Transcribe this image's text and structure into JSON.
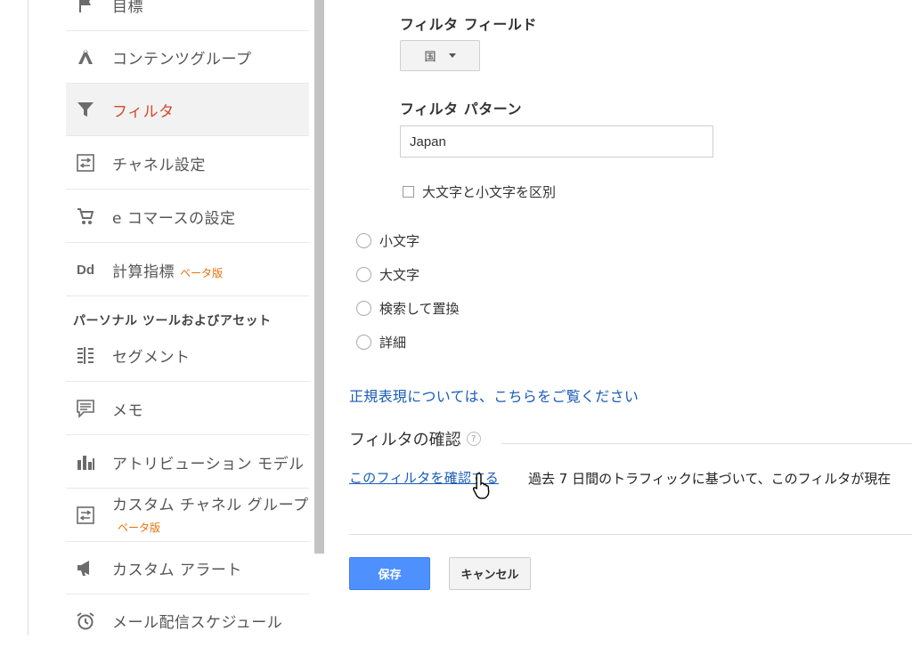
{
  "sidebar": {
    "items": [
      {
        "label": "目標",
        "icon": "flag-icon"
      },
      {
        "label": "コンテンツグループ",
        "icon": "content-group-icon"
      },
      {
        "label": "フィルタ",
        "icon": "filter-icon",
        "active": true
      },
      {
        "label": "チャネル設定",
        "icon": "channel-settings-icon"
      },
      {
        "label": "e コマースの設定",
        "icon": "cart-icon"
      },
      {
        "label": "計算指標",
        "icon": "dd-icon",
        "icon_text": "Dd",
        "badge": "ベータ版"
      },
      {
        "label": "セグメント",
        "icon": "segment-icon"
      },
      {
        "label": "メモ",
        "icon": "memo-icon"
      },
      {
        "label": "アトリビューション モデル",
        "icon": "attribution-icon"
      },
      {
        "label": "カスタム チャネル グループ",
        "icon": "custom-channel-icon",
        "badge": "ベータ版"
      },
      {
        "label": "カスタム アラート",
        "icon": "megaphone-icon"
      },
      {
        "label": "メール配信スケジュール",
        "icon": "alarm-clock-icon"
      }
    ],
    "section_title": "パーソナル ツールおよびアセット"
  },
  "form": {
    "filter_field_label": "フィルタ フィールド",
    "filter_field_value": "国",
    "filter_pattern_label": "フィルタ パターン",
    "filter_pattern_value": "Japan",
    "case_sensitive_label": "大文字と小文字を区別",
    "radio_options": [
      "小文字",
      "大文字",
      "検索して置換",
      "詳細"
    ],
    "regex_link": "正規表現については、こちらをご覧ください",
    "verify_heading": "フィルタの確認",
    "verify_link": "このフィルタを確認する",
    "verify_description": "過去 7 日間のトラフィックに基づいて、このフィルタが現在",
    "save_label": "保存",
    "cancel_label": "キャンセル"
  },
  "colors": {
    "active": "#d5482d",
    "beta": "#e8710a",
    "link": "#1a5db8",
    "primary_button": "#4d90fe"
  }
}
